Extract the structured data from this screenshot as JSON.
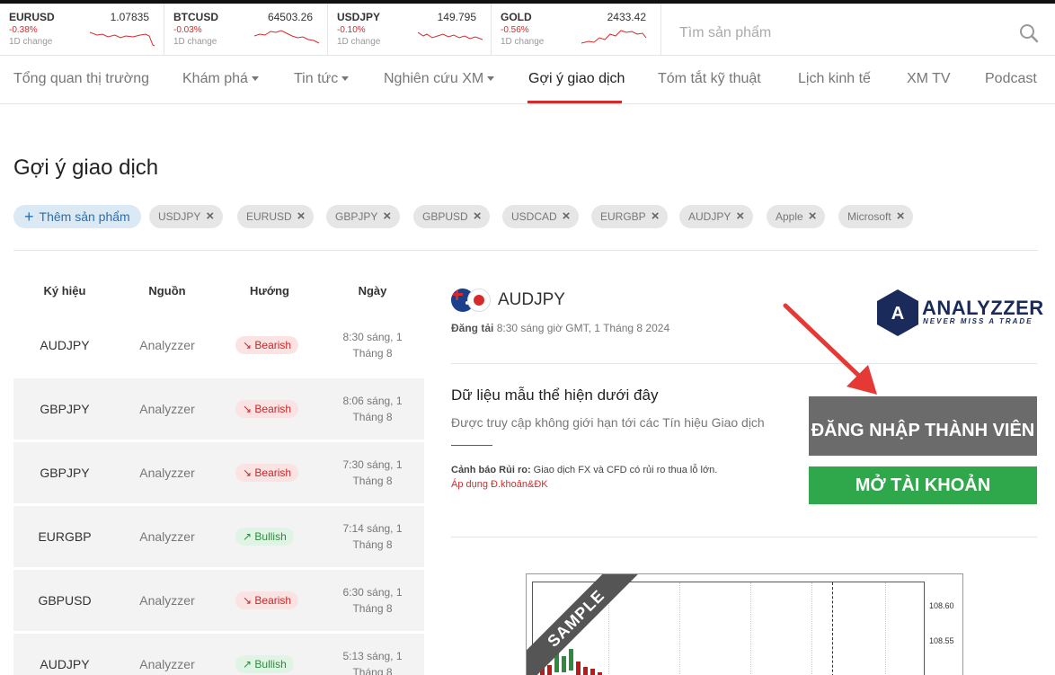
{
  "ticker": [
    {
      "symbol": "EURUSD",
      "price": "1.07835",
      "change": "-0.38%",
      "label": "1D change"
    },
    {
      "symbol": "BTCUSD",
      "price": "64503.26",
      "change": "-0.03%",
      "label": "1D change"
    },
    {
      "symbol": "USDJPY",
      "price": "149.795",
      "change": "-0.10%",
      "label": "1D change"
    },
    {
      "symbol": "GOLD",
      "price": "2433.42",
      "change": "-0.56%",
      "label": "1D change"
    }
  ],
  "search": {
    "placeholder": "Tìm sản phẩm",
    "icon": "search-icon"
  },
  "nav": [
    {
      "label": "Tổng quan thị trường"
    },
    {
      "label": "Khám phá"
    },
    {
      "label": "Tin tức"
    },
    {
      "label": "Nghiên cứu XM"
    },
    {
      "label": "Gợi ý giao dịch"
    },
    {
      "label": "Tóm tắt kỹ thuật"
    },
    {
      "label": "Lịch kinh tế"
    },
    {
      "label": "XM TV"
    },
    {
      "label": "Podcast"
    }
  ],
  "page_title": "Gợi ý giao dịch",
  "add_product": "Thêm sản phẩm",
  "chips": [
    "USDJPY",
    "EURUSD",
    "GBPJPY",
    "GBPUSD",
    "USDCAD",
    "EURGBP",
    "AUDJPY",
    "Apple",
    "Microsoft"
  ],
  "table": {
    "headers": [
      "Ký hiệu",
      "Nguồn",
      "Hướng",
      "Ngày"
    ],
    "rows": [
      {
        "symbol": "AUDJPY",
        "source": "Analyzzer",
        "direction": "Bearish",
        "date1": "8:30 sáng, 1",
        "date2": "Tháng 8"
      },
      {
        "symbol": "GBPJPY",
        "source": "Analyzzer",
        "direction": "Bearish",
        "date1": "8:06 sáng, 1",
        "date2": "Tháng 8"
      },
      {
        "symbol": "GBPJPY",
        "source": "Analyzzer",
        "direction": "Bearish",
        "date1": "7:30 sáng, 1",
        "date2": "Tháng 8"
      },
      {
        "symbol": "EURGBP",
        "source": "Analyzzer",
        "direction": "Bullish",
        "date1": "7:14 sáng, 1",
        "date2": "Tháng 8"
      },
      {
        "symbol": "GBPUSD",
        "source": "Analyzzer",
        "direction": "Bearish",
        "date1": "6:30 sáng, 1",
        "date2": "Tháng 8"
      },
      {
        "symbol": "AUDJPY",
        "source": "Analyzzer",
        "direction": "Bullish",
        "date1": "5:13 sáng, 1",
        "date2": "Tháng 8"
      }
    ]
  },
  "detail": {
    "pair": "AUDJPY",
    "posted_label": "Đăng tải",
    "posted_value": "8:30 sáng giờ GMT, 1 Tháng 8 2024",
    "logo_word": "ANALYZZER",
    "logo_letter": "A",
    "logo_tag": "NEVER MISS A TRADE",
    "promo_title": "Dữ liệu mẫu thể hiện dưới đây",
    "promo_sub": "Được truy cập không giới hạn tới các Tín hiệu Giao dịch",
    "risk_label": "Cảnh báo Rủi ro:",
    "risk_text": "Giao dịch FX và CFD có rủi ro thua lỗ lớn.",
    "risk_link": "Áp dụng Đ.khoản&ĐK",
    "login_button": "ĐĂNG NHẬP THÀNH VIÊN",
    "open_button": "MỞ TÀI KHOẢN"
  },
  "chart": {
    "watermark": "SAMPLE",
    "yticks": [
      "108.60",
      "108.55"
    ]
  },
  "colors": {
    "accent_red": "#d62b2b",
    "bull_green": "#2ea84a",
    "login_gray": "#6b6b6b"
  }
}
